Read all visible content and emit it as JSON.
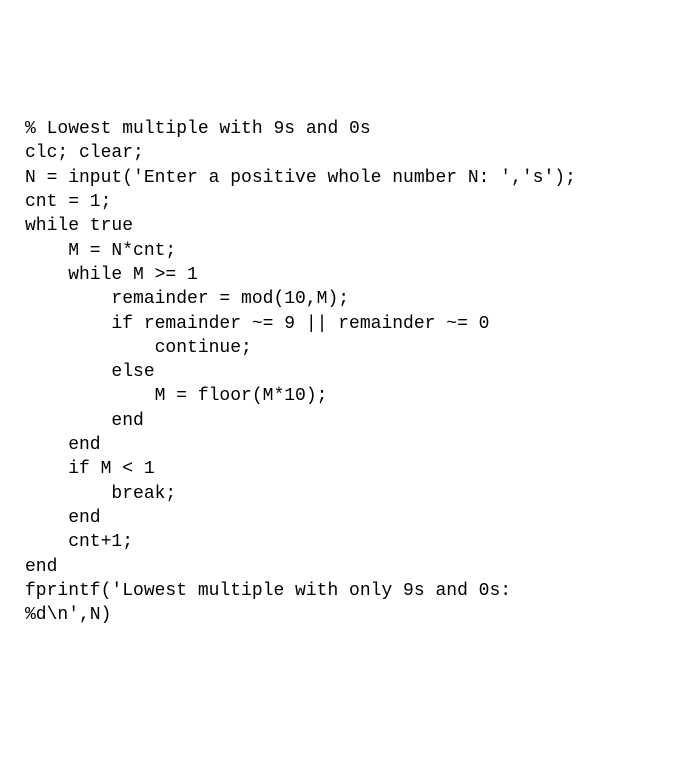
{
  "code": {
    "lines": [
      "% Lowest multiple with 9s and 0s",
      "clc; clear;",
      "N = input('Enter a positive whole number N: ','s');",
      "cnt = 1;",
      "while true",
      "    M = N*cnt;",
      "    while M >= 1",
      "        remainder = mod(10,M);",
      "        if remainder ~= 9 || remainder ~= 0",
      "            continue;",
      "        else",
      "            M = floor(M*10);",
      "        end",
      "    end",
      "    if M < 1",
      "        break;",
      "    end",
      "    cnt+1;",
      "end",
      "fprintf('Lowest multiple with only 9s and 0s:",
      "%d\\n',N)"
    ]
  }
}
